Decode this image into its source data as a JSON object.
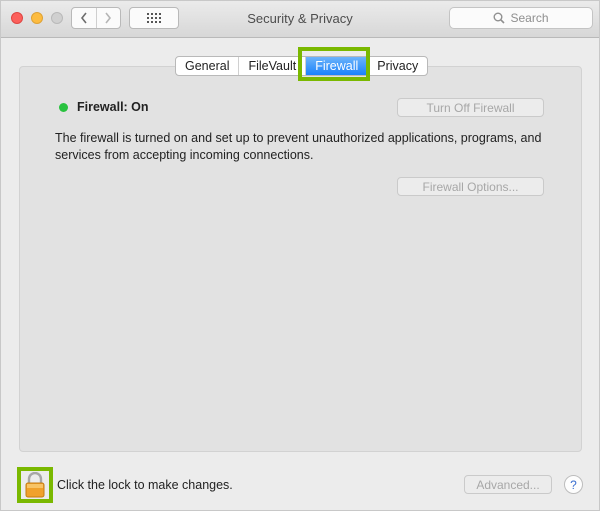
{
  "window": {
    "title": "Security & Privacy",
    "search_placeholder": "Search"
  },
  "tabs": [
    {
      "label": "General"
    },
    {
      "label": "FileVault"
    },
    {
      "label": "Firewall"
    },
    {
      "label": "Privacy"
    }
  ],
  "firewall": {
    "status": "Firewall: On",
    "turn_off_button": "Turn Off Firewall",
    "description": "The firewall is turned on and set up to prevent unauthorized applications, programs, and services from accepting incoming connections.",
    "options_button": "Firewall Options..."
  },
  "footer": {
    "lock_text": "Click the lock to make changes.",
    "advanced_button": "Advanced...",
    "help_label": "?"
  },
  "colors": {
    "highlight": "#7ab800",
    "status_on": "#29c23f",
    "tab_active": "#1a82fb"
  }
}
